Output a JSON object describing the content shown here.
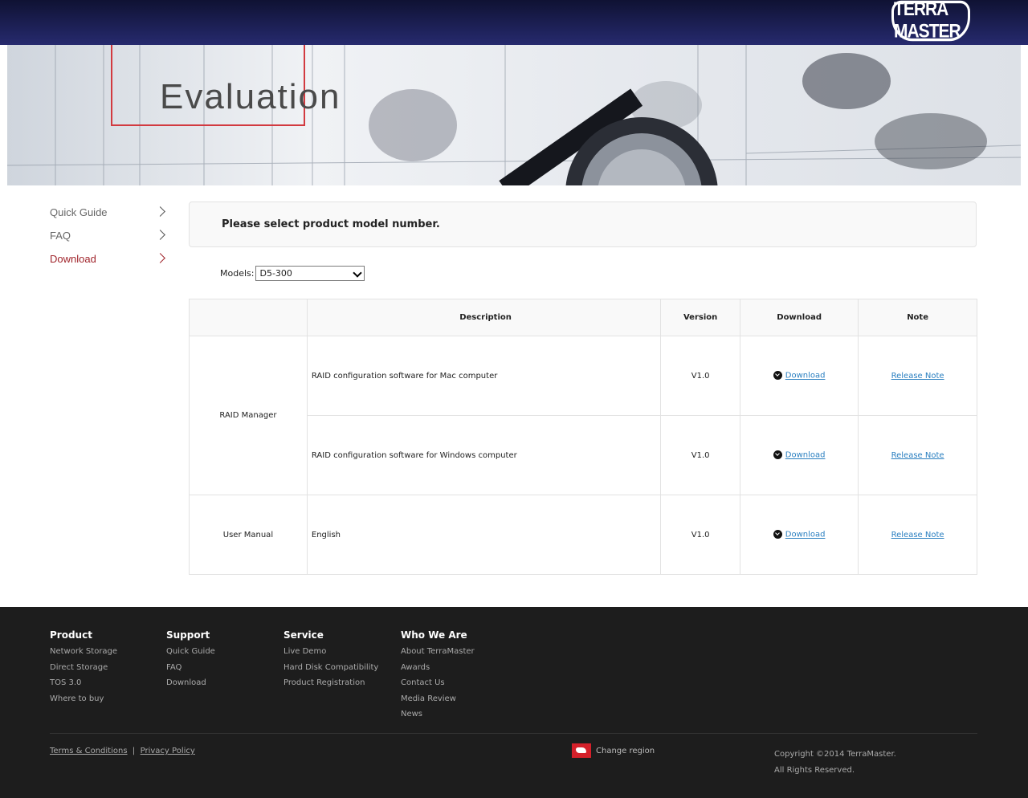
{
  "header": {
    "logo_text": "TERRA MASTER"
  },
  "banner": {
    "title": "Evaluation"
  },
  "sidebar": {
    "items": [
      {
        "label": "Quick Guide"
      },
      {
        "label": "FAQ"
      },
      {
        "label": "Download"
      }
    ]
  },
  "main": {
    "prompt": "Please select product model number.",
    "models_label": "Models:",
    "models_selected": "D5-300",
    "table": {
      "headers": [
        "",
        "Description",
        "Version",
        "Download",
        "Note"
      ],
      "groups": [
        {
          "name": "RAID Manager",
          "rows": [
            {
              "description": "RAID configuration software for Mac computer",
              "version": "V1.0",
              "download": "Download",
              "note": "Release Note"
            },
            {
              "description": "RAID configuration software for Windows computer",
              "version": "V1.0",
              "download": "Download",
              "note": "Release Note"
            }
          ]
        },
        {
          "name": "User Manual",
          "rows": [
            {
              "description": "English",
              "version": "V1.0",
              "download": "Download",
              "note": "Release Note"
            }
          ]
        }
      ]
    }
  },
  "footer": {
    "columns": [
      {
        "title": "Product",
        "links": [
          "Network Storage",
          "Direct Storage",
          "TOS 3.0",
          "Where to buy"
        ]
      },
      {
        "title": "Support",
        "links": [
          "Quick Guide",
          "FAQ",
          "Download"
        ]
      },
      {
        "title": "Service",
        "links": [
          "Live Demo",
          "Hard Disk Compatibility",
          "Product Registration"
        ]
      },
      {
        "title": "Who We Are",
        "links": [
          "About TerraMaster",
          "Awards",
          "Contact Us",
          "Media Review",
          "News"
        ]
      }
    ],
    "terms": "Terms & Conditions",
    "separator": "|",
    "privacy": "Privacy Policy",
    "region": "Change region",
    "copyright": "Copyright ©2014 TerraMaster.",
    "rights": "All Rights Reserved."
  }
}
